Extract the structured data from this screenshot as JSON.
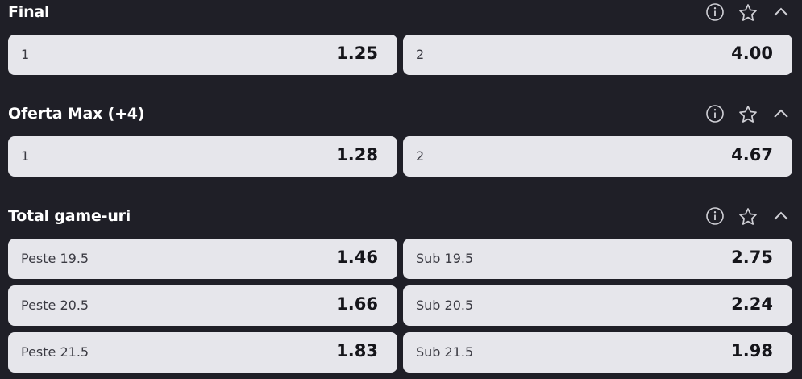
{
  "markets": [
    {
      "title": "Final",
      "icons": [
        "info-icon",
        "star-icon",
        "chevron-up-icon"
      ],
      "rows": [
        [
          {
            "label": "1",
            "odd": "1.25"
          },
          {
            "label": "2",
            "odd": "4.00"
          }
        ]
      ]
    },
    {
      "title": "Oferta Max (+4)",
      "icons": [
        "info-icon",
        "star-icon",
        "chevron-up-icon"
      ],
      "rows": [
        [
          {
            "label": "1",
            "odd": "1.28"
          },
          {
            "label": "2",
            "odd": "4.67"
          }
        ]
      ]
    },
    {
      "title": "Total game-uri",
      "icons": [
        "info-icon",
        "star-icon",
        "chevron-up-icon"
      ],
      "rows": [
        [
          {
            "label": "Peste 19.5",
            "odd": "1.46"
          },
          {
            "label": "Sub 19.5",
            "odd": "2.75"
          }
        ],
        [
          {
            "label": "Peste 20.5",
            "odd": "1.66"
          },
          {
            "label": "Sub 20.5",
            "odd": "2.24"
          }
        ],
        [
          {
            "label": "Peste 21.5",
            "odd": "1.83"
          },
          {
            "label": "Sub 21.5",
            "odd": "1.98"
          }
        ]
      ]
    }
  ]
}
